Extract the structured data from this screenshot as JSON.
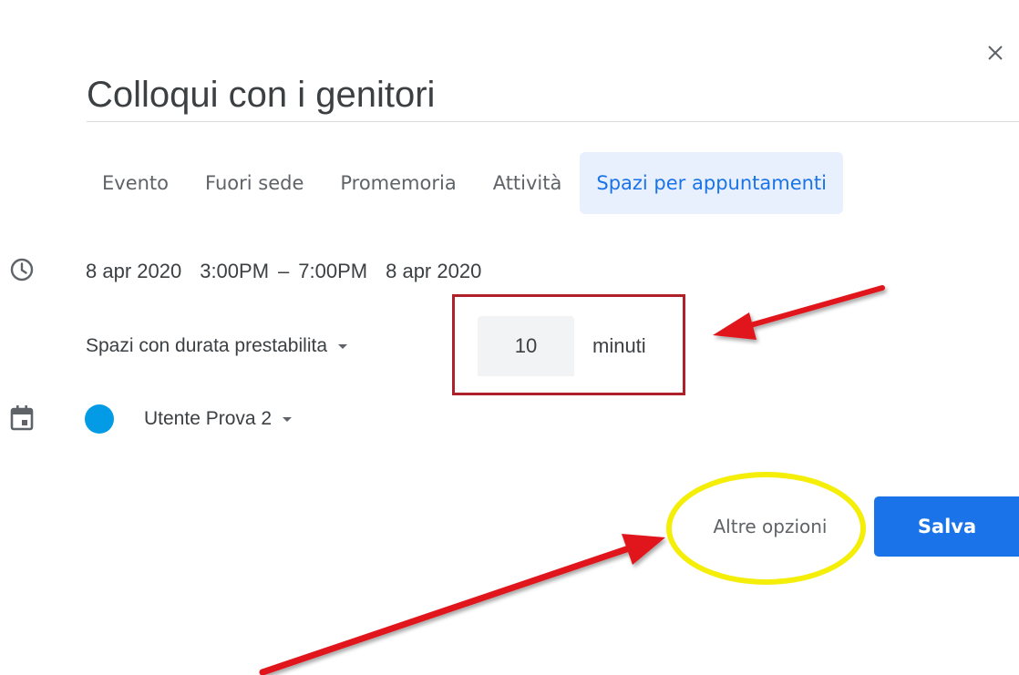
{
  "dialog": {
    "title": "Colloqui con i genitori"
  },
  "tabs": [
    {
      "label": "Evento",
      "active": false
    },
    {
      "label": "Fuori sede",
      "active": false
    },
    {
      "label": "Promemoria",
      "active": false
    },
    {
      "label": "Attività",
      "active": false
    },
    {
      "label": "Spazi per appuntamenti",
      "active": true
    }
  ],
  "time": {
    "start_date": "8 apr 2020",
    "start_time": "3:00PM",
    "separator": "–",
    "end_time": "7:00PM",
    "end_date": "8 apr 2020"
  },
  "slots": {
    "type_label": "Spazi con durata prestabilita",
    "duration_value": "10",
    "duration_unit": "minuti"
  },
  "calendar": {
    "name": "Utente Prova 2",
    "color": "#039be5"
  },
  "actions": {
    "more_options_label": "Altre opzioni",
    "save_label": "Salva"
  },
  "icons": {
    "close": "close-icon",
    "clock": "clock-icon",
    "calendar": "calendar-icon"
  },
  "colors": {
    "accent": "#1a73e8",
    "active_tab_bg": "#e8f0fe",
    "annotation_red": "#e0141b",
    "annotation_box": "#b0202a",
    "annotation_yellow": "#f4ee08"
  }
}
